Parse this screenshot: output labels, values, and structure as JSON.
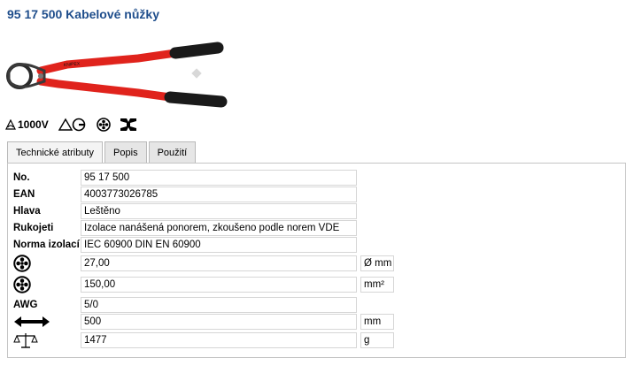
{
  "product": {
    "title": "95 17 500 Kabelové nůžky",
    "brand_mark": "KNIPEX"
  },
  "badges": {
    "voltage": "1000V"
  },
  "tabs": [
    {
      "label": "Technické atributy",
      "active": true
    },
    {
      "label": "Popis",
      "active": false
    },
    {
      "label": "Použití",
      "active": false
    }
  ],
  "attributes": {
    "no": {
      "label": "No.",
      "value": "95 17 500"
    },
    "ean": {
      "label": "EAN",
      "value": "4003773026785"
    },
    "hlava": {
      "label": "Hlava",
      "value": "Leštěno"
    },
    "rukojeti": {
      "label": "Rukojeti",
      "value": "Izolace nanášená ponorem, zkoušeno podle norem VDE"
    },
    "norma": {
      "label": "Norma izolací",
      "value": "IEC 60900 DIN EN 60900"
    },
    "diameter": {
      "icon": "cable-cross-section-icon",
      "value": "27,00",
      "unit": "Ø mm"
    },
    "area": {
      "icon": "cable-cross-section-icon",
      "value": "150,00",
      "unit": "mm²"
    },
    "awg": {
      "label": "AWG",
      "value": "5/0"
    },
    "length": {
      "icon": "length-arrow-icon",
      "value": "500",
      "unit": "mm"
    },
    "weight": {
      "icon": "scale-icon",
      "value": "1477",
      "unit": "g"
    }
  },
  "colors": {
    "title": "#1f4e8c",
    "handle_red": "#e0231c",
    "grip_black": "#1a1a1a"
  }
}
